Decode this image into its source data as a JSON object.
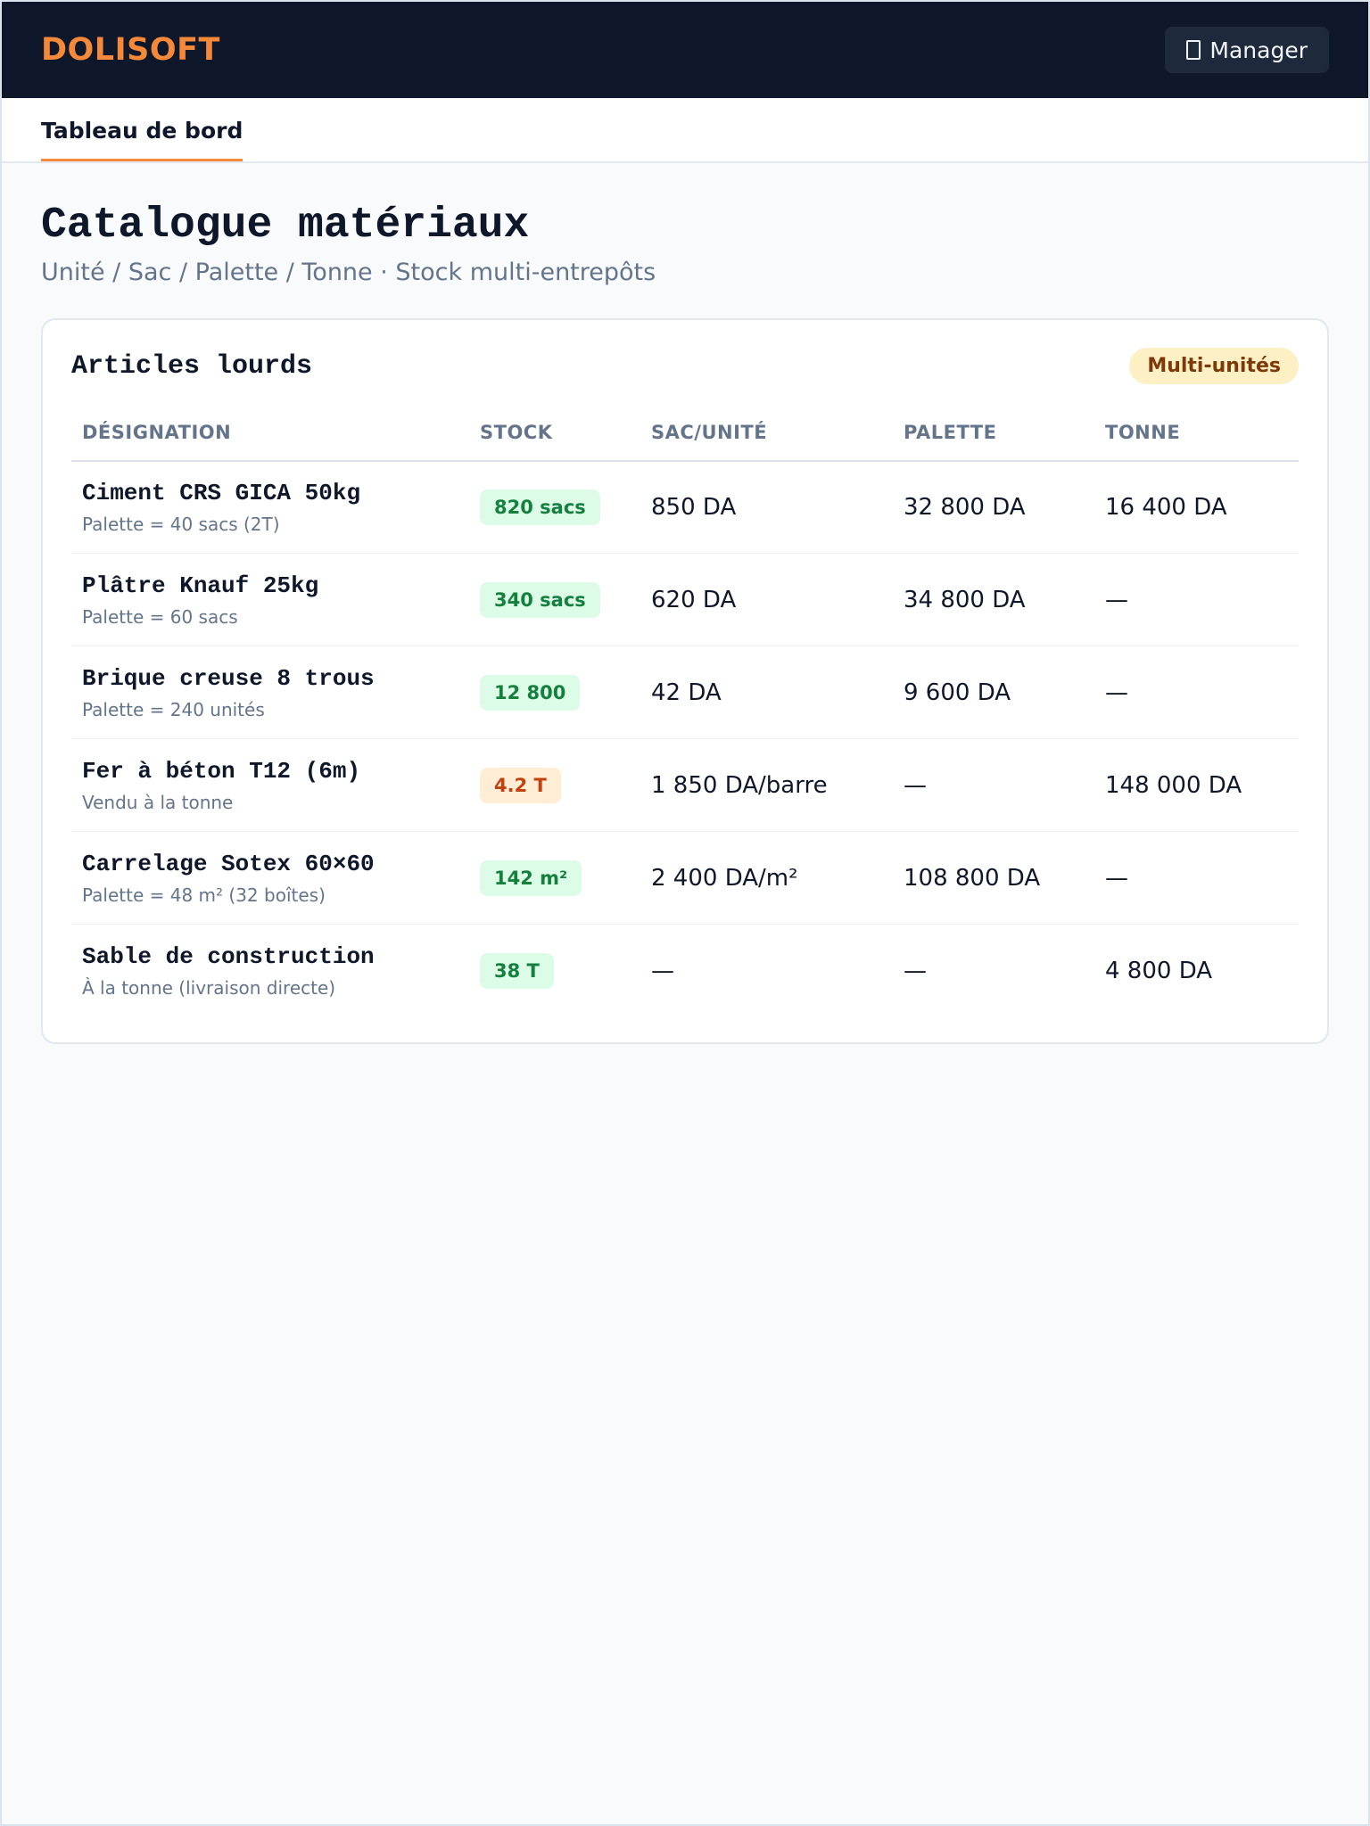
{
  "app": {
    "brand": "DOLISOFT",
    "user_button": "Manager",
    "user_icon": "user-icon"
  },
  "tabs": [
    {
      "label": "Tableau de bord",
      "active": true
    }
  ],
  "page": {
    "title": "Catalogue matériaux",
    "subtitle": "Unité / Sac / Palette / Tonne · Stock multi-entrepôts"
  },
  "card": {
    "title": "Articles lourds",
    "badge": "Multi-unités",
    "columns": [
      "DÉSIGNATION",
      "STOCK",
      "SAC/UNITÉ",
      "PALETTE",
      "TONNE"
    ],
    "rows": [
      {
        "name": "Ciment CRS GICA 50kg",
        "sub": "Palette = 40 sacs (2T)",
        "stock": "820 sacs",
        "stock_status": "ok",
        "unit": "850 DA",
        "palette": "32 800 DA",
        "tonne": "16 400 DA"
      },
      {
        "name": "Plâtre Knauf 25kg",
        "sub": "Palette = 60 sacs",
        "stock": "340 sacs",
        "stock_status": "ok",
        "unit": "620 DA",
        "palette": "34 800 DA",
        "tonne": "—"
      },
      {
        "name": "Brique creuse 8 trous",
        "sub": "Palette = 240 unités",
        "stock": "12 800",
        "stock_status": "ok",
        "unit": "42 DA",
        "palette": "9 600 DA",
        "tonne": "—"
      },
      {
        "name": "Fer à béton T12 (6m)",
        "sub": "Vendu à la tonne",
        "stock": "4.2 T",
        "stock_status": "warn",
        "unit": "1 850 DA/barre",
        "palette": "—",
        "tonne": "148 000 DA"
      },
      {
        "name": "Carrelage Sotex 60×60",
        "sub": "Palette = 48 m² (32 boîtes)",
        "stock": "142 m²",
        "stock_status": "ok",
        "unit": "2 400 DA/m²",
        "palette": "108 800 DA",
        "tonne": "—"
      },
      {
        "name": "Sable de construction",
        "sub": "À la tonne (livraison directe)",
        "stock": "38 T",
        "stock_status": "ok",
        "unit": "—",
        "palette": "—",
        "tonne": "4 800 DA"
      }
    ]
  },
  "colors": {
    "brand": "#f5893a",
    "topbar": "#0f172a",
    "ok": "#15803d",
    "warn": "#c2410c"
  }
}
